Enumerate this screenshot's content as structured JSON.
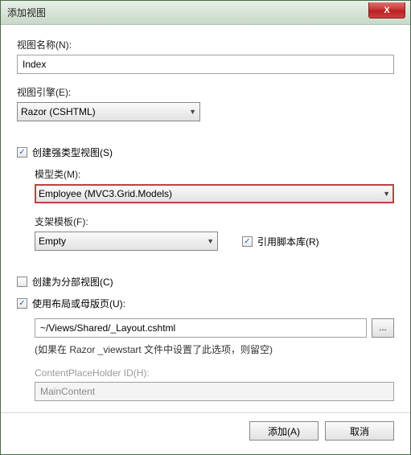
{
  "title": "添加视图",
  "close_glyph": "X",
  "fields": {
    "view_name_label": "视图名称(N):",
    "view_name_value": "Index",
    "view_engine_label": "视图引擎(E):",
    "view_engine_value": "Razor (CSHTML)",
    "strong_typed_label": "创建强类型视图(S)",
    "model_class_label": "模型类(M):",
    "model_class_value": "Employee (MVC3.Grid.Models)",
    "scaffold_label": "支架模板(F):",
    "scaffold_value": "Empty",
    "ref_scripts_label": "引用脚本库(R)",
    "partial_view_label": "创建为分部视图(C)",
    "use_layout_label": "使用布局或母版页(U):",
    "layout_path_value": "~/Views/Shared/_Layout.cshtml",
    "layout_hint": "(如果在 Razor _viewstart 文件中设置了此选项，则留空)",
    "placeholder_label": "ContentPlaceHolder ID(H):",
    "placeholder_value": "MainContent",
    "browse_label": "..."
  },
  "checkboxes": {
    "strong_typed": true,
    "ref_scripts": true,
    "partial_view": false,
    "use_layout": true
  },
  "buttons": {
    "add": "添加(A)",
    "cancel": "取消"
  },
  "check_glyph": "✓",
  "arrow_glyph": "▼"
}
